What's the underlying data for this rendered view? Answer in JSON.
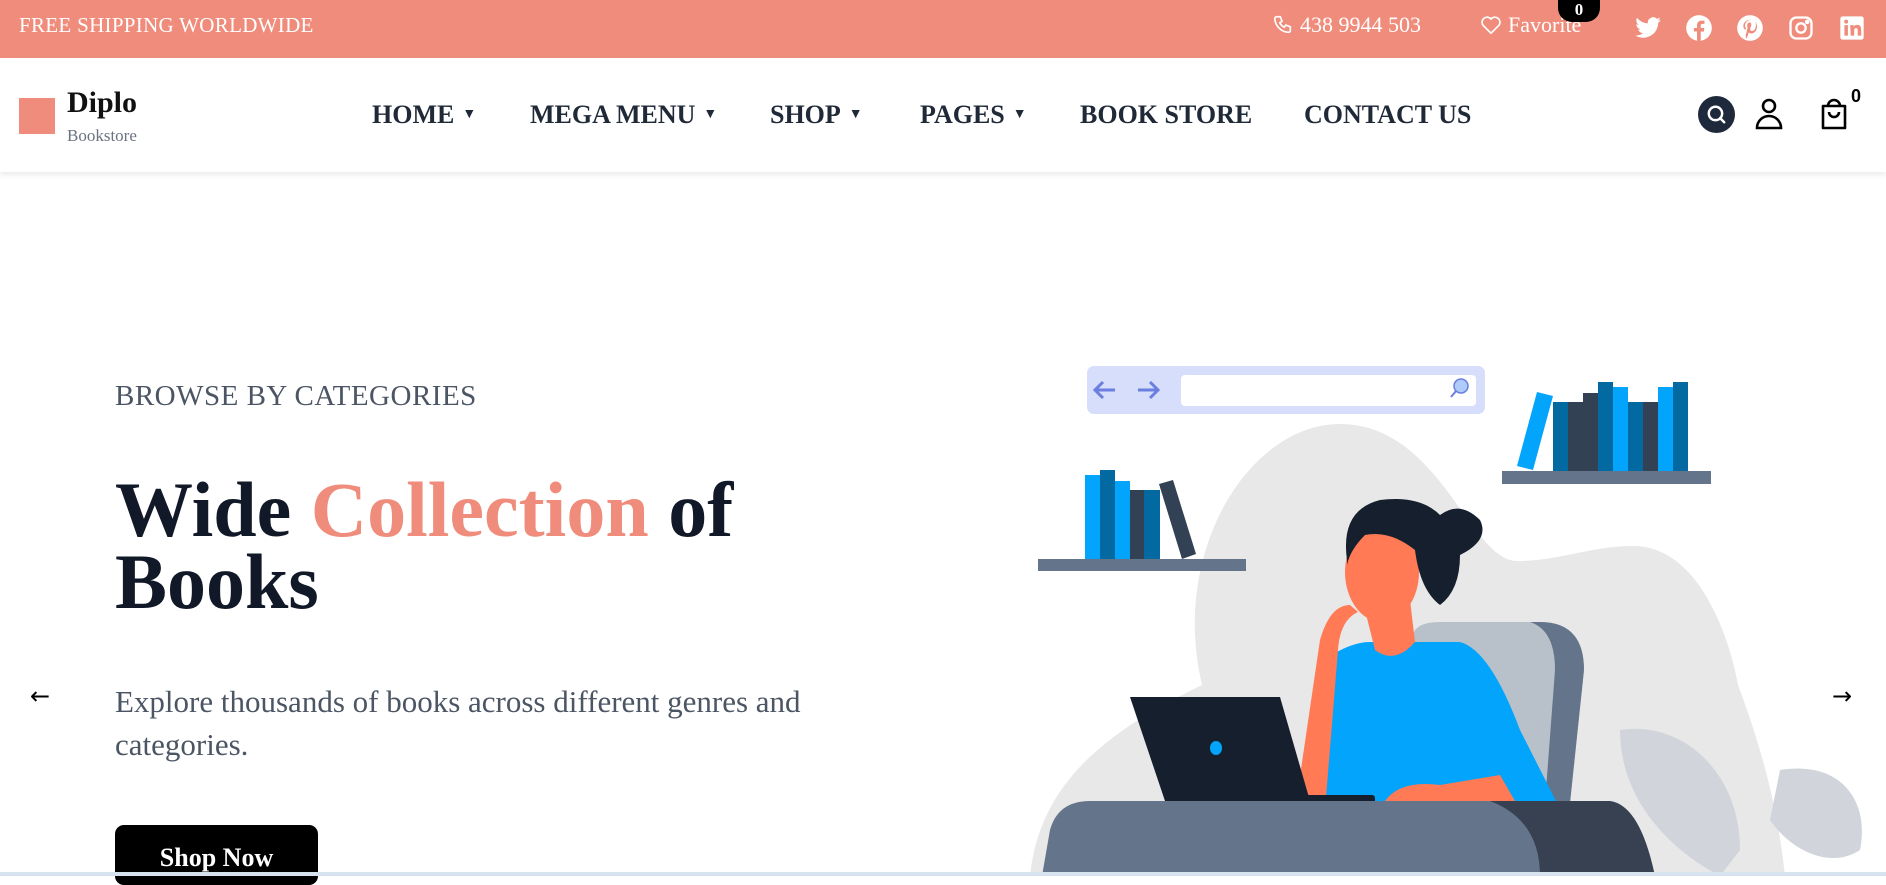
{
  "topbar": {
    "shipping": "FREE SHIPPING WORLDWIDE",
    "phone": "438 9944 503",
    "favorite_label": "Favorite",
    "favorite_count": "0",
    "social": [
      "twitter-icon",
      "facebook-icon",
      "pinterest-icon",
      "instagram-icon",
      "linkedin-icon"
    ]
  },
  "header": {
    "logo_name": "Diplo",
    "logo_sub": "Bookstore",
    "nav": [
      {
        "label": "HOME",
        "dropdown": true
      },
      {
        "label": "MEGA MENU",
        "dropdown": true
      },
      {
        "label": "SHOP",
        "dropdown": true
      },
      {
        "label": "PAGES",
        "dropdown": true
      },
      {
        "label": "BOOK STORE",
        "dropdown": false
      },
      {
        "label": "CONTACT US",
        "dropdown": false
      }
    ],
    "caret": "▼",
    "cart_count": "0"
  },
  "hero": {
    "eyebrow": "BROWSE BY CATEGORIES",
    "title_1": "Wide",
    "title_accent": "Collection",
    "title_2": "of",
    "title_3": "Books",
    "description": "Explore thousands of books across different genres and categories.",
    "button": "Shop Now",
    "prev": "←",
    "next": "→"
  },
  "colors": {
    "brand": "#EF8C7B",
    "text_dark": "#111827",
    "text_muted": "#4b5563",
    "illustration_blue": "#03A4FB"
  }
}
